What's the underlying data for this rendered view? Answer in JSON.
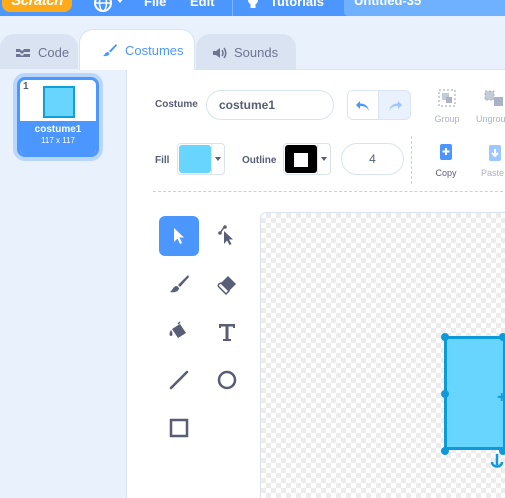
{
  "menu": {
    "logo": "Scratch",
    "file": "File",
    "edit": "Edit",
    "tutorials": "Tutorials",
    "project_title": "Untitled-35"
  },
  "tabs": [
    {
      "label": "Code",
      "icon": "code-icon"
    },
    {
      "label": "Costumes",
      "icon": "brush-icon"
    },
    {
      "label": "Sounds",
      "icon": "speaker-icon"
    }
  ],
  "active_tab": "Costumes",
  "costumes": [
    {
      "number": "1",
      "name": "costume1",
      "size": "117 x 117"
    }
  ],
  "editor": {
    "costume_label": "Costume",
    "costume_name": "costume1",
    "group_label": "Group",
    "ungroup_label": "Ungroup",
    "copy_label": "Copy",
    "paste_label": "Paste",
    "fill_label": "Fill",
    "outline_label": "Outline",
    "stroke_width": "4"
  },
  "colors": {
    "accent": "#4c97ff",
    "fill_color": "#68d5ff",
    "outline_color": "#000000",
    "shape_outline": "#0e9ad8"
  },
  "tools": [
    {
      "name": "select",
      "icon": "arrow-select-icon",
      "active": true
    },
    {
      "name": "reshape",
      "icon": "reshape-icon",
      "active": false
    },
    {
      "name": "brush",
      "icon": "brush-icon",
      "active": false
    },
    {
      "name": "eraser",
      "icon": "eraser-icon",
      "active": false
    },
    {
      "name": "fill",
      "icon": "paint-bucket-icon",
      "active": false
    },
    {
      "name": "text",
      "icon": "text-icon",
      "active": false
    },
    {
      "name": "line",
      "icon": "line-icon",
      "active": false
    },
    {
      "name": "circle",
      "icon": "circle-icon",
      "active": false
    },
    {
      "name": "rectangle",
      "icon": "rectangle-icon",
      "active": false
    }
  ]
}
